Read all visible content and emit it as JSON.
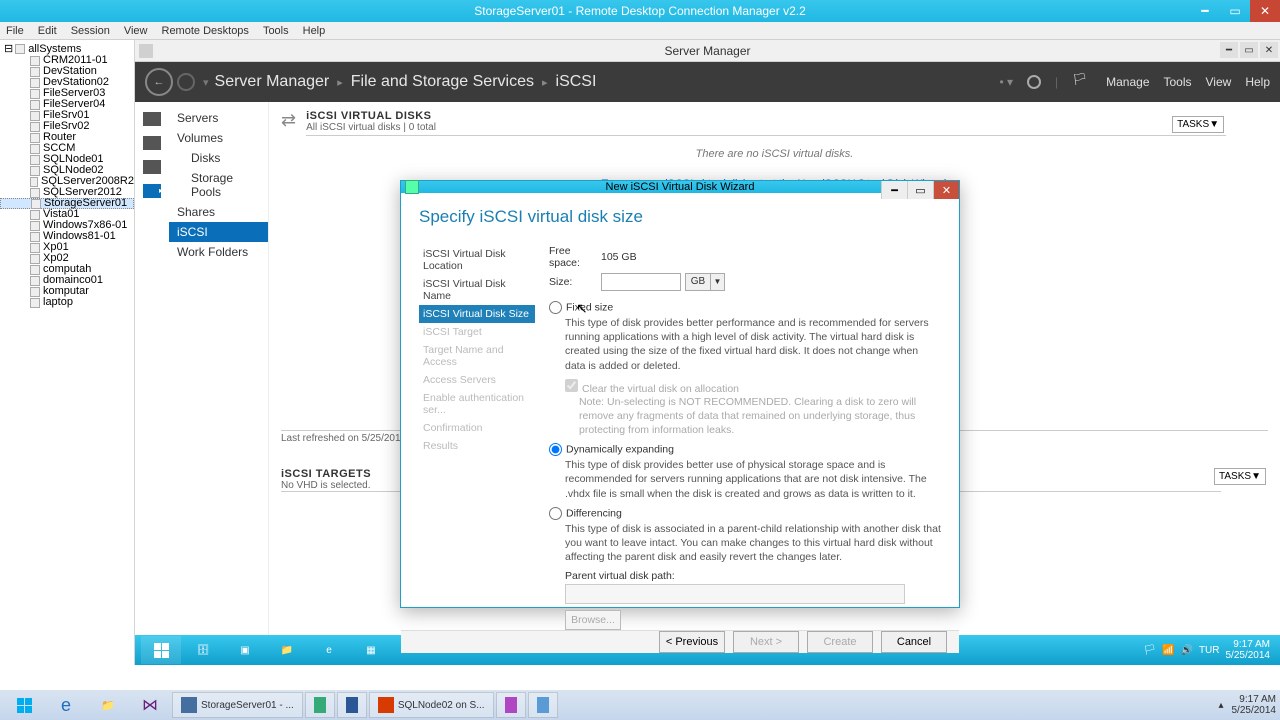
{
  "rdcman": {
    "title": "StorageServer01 - Remote Desktop Connection Manager v2.2",
    "menu": [
      "File",
      "Edit",
      "Session",
      "View",
      "Remote Desktops",
      "Tools",
      "Help"
    ],
    "tree_root": "allSystems",
    "tree": [
      "CRM2011-01",
      "DevStation",
      "DevStation02",
      "FileServer03",
      "FileServer04",
      "FileSrv01",
      "FileSrv02",
      "Router",
      "SCCM",
      "SQLNode01",
      "SQLNode02",
      "SQLServer2008R2",
      "SQLServer2012",
      "StorageServer01",
      "Vista01",
      "Windows7x86-01",
      "Windows81-01",
      "Xp01",
      "Xp02",
      "computah",
      "domainco01",
      "komputar",
      "laptop"
    ],
    "tree_selected": "StorageServer01"
  },
  "sm": {
    "window_title": "Server Manager",
    "breadcrumb": [
      "Server Manager",
      "File and Storage Services",
      "iSCSI"
    ],
    "menu_right": [
      "Manage",
      "Tools",
      "View",
      "Help"
    ],
    "nav": [
      "Servers",
      "Volumes",
      "Disks",
      "Storage Pools",
      "Shares",
      "iSCSI",
      "Work Folders"
    ],
    "nav_selected": "iSCSI",
    "section1_title": "iSCSI VIRTUAL DISKS",
    "section1_sub": "All iSCSI virtual disks | 0 total",
    "tasks_label": "TASKS",
    "empty_msg": "There are no iSCSI virtual disks.",
    "empty_link": "To create an iSCSI virtual disk, start the New iSCSI Virtual Disk Wizard.",
    "refresh_msg": "Last refreshed on 5/25/201",
    "section2_title": "iSCSI TARGETS",
    "section2_sub": "No VHD is selected."
  },
  "wizard": {
    "title": "New iSCSI Virtual Disk Wizard",
    "heading": "Specify iSCSI virtual disk size",
    "steps": [
      "iSCSI Virtual Disk Location",
      "iSCSI Virtual Disk Name",
      "iSCSI Virtual Disk Size",
      "iSCSI Target",
      "Target Name and Access",
      "Access Servers",
      "Enable authentication ser...",
      "Confirmation",
      "Results"
    ],
    "step_current": "iSCSI Virtual Disk Size",
    "free_label": "Free space:",
    "free_val": "105 GB",
    "size_label": "Size:",
    "size_unit": "GB",
    "opt_fixed": "Fixed size",
    "opt_fixed_desc": "This type of disk provides better performance and is recommended for servers running applications with a high level of disk activity. The virtual hard disk is created using the size of the fixed virtual hard disk. It does not change when data is added or deleted.",
    "chk_clear": "Clear the virtual disk on allocation",
    "chk_note": "Note: Un-selecting is NOT RECOMMENDED. Clearing a disk to zero will remove any fragments of data that remained on underlying storage, thus protecting from information leaks.",
    "opt_dyn": "Dynamically expanding",
    "opt_dyn_desc": "This type of disk provides better use of physical storage space and is recommended for servers running applications that are not disk intensive. The .vhdx file is small when the disk is created and grows as data is written to it.",
    "opt_diff": "Differencing",
    "opt_diff_desc": "This type of disk is associated in a parent-child relationship with another disk that you want to leave intact. You can make changes to this virtual hard disk without affecting the parent disk and easily revert the changes later.",
    "parent_label": "Parent virtual disk path:",
    "browse": "Browse...",
    "btn_prev": "< Previous",
    "btn_next": "Next >",
    "btn_create": "Create",
    "btn_cancel": "Cancel"
  },
  "remote_taskbar": {
    "lang": "TUR",
    "time": "9:17 AM",
    "date": "5/25/2014"
  },
  "host_taskbar": {
    "tasks": [
      "StorageServer01 - ...",
      "",
      "",
      "SQLNode02 on S...",
      "",
      ""
    ],
    "time": "9:17 AM",
    "date": "5/25/2014"
  }
}
